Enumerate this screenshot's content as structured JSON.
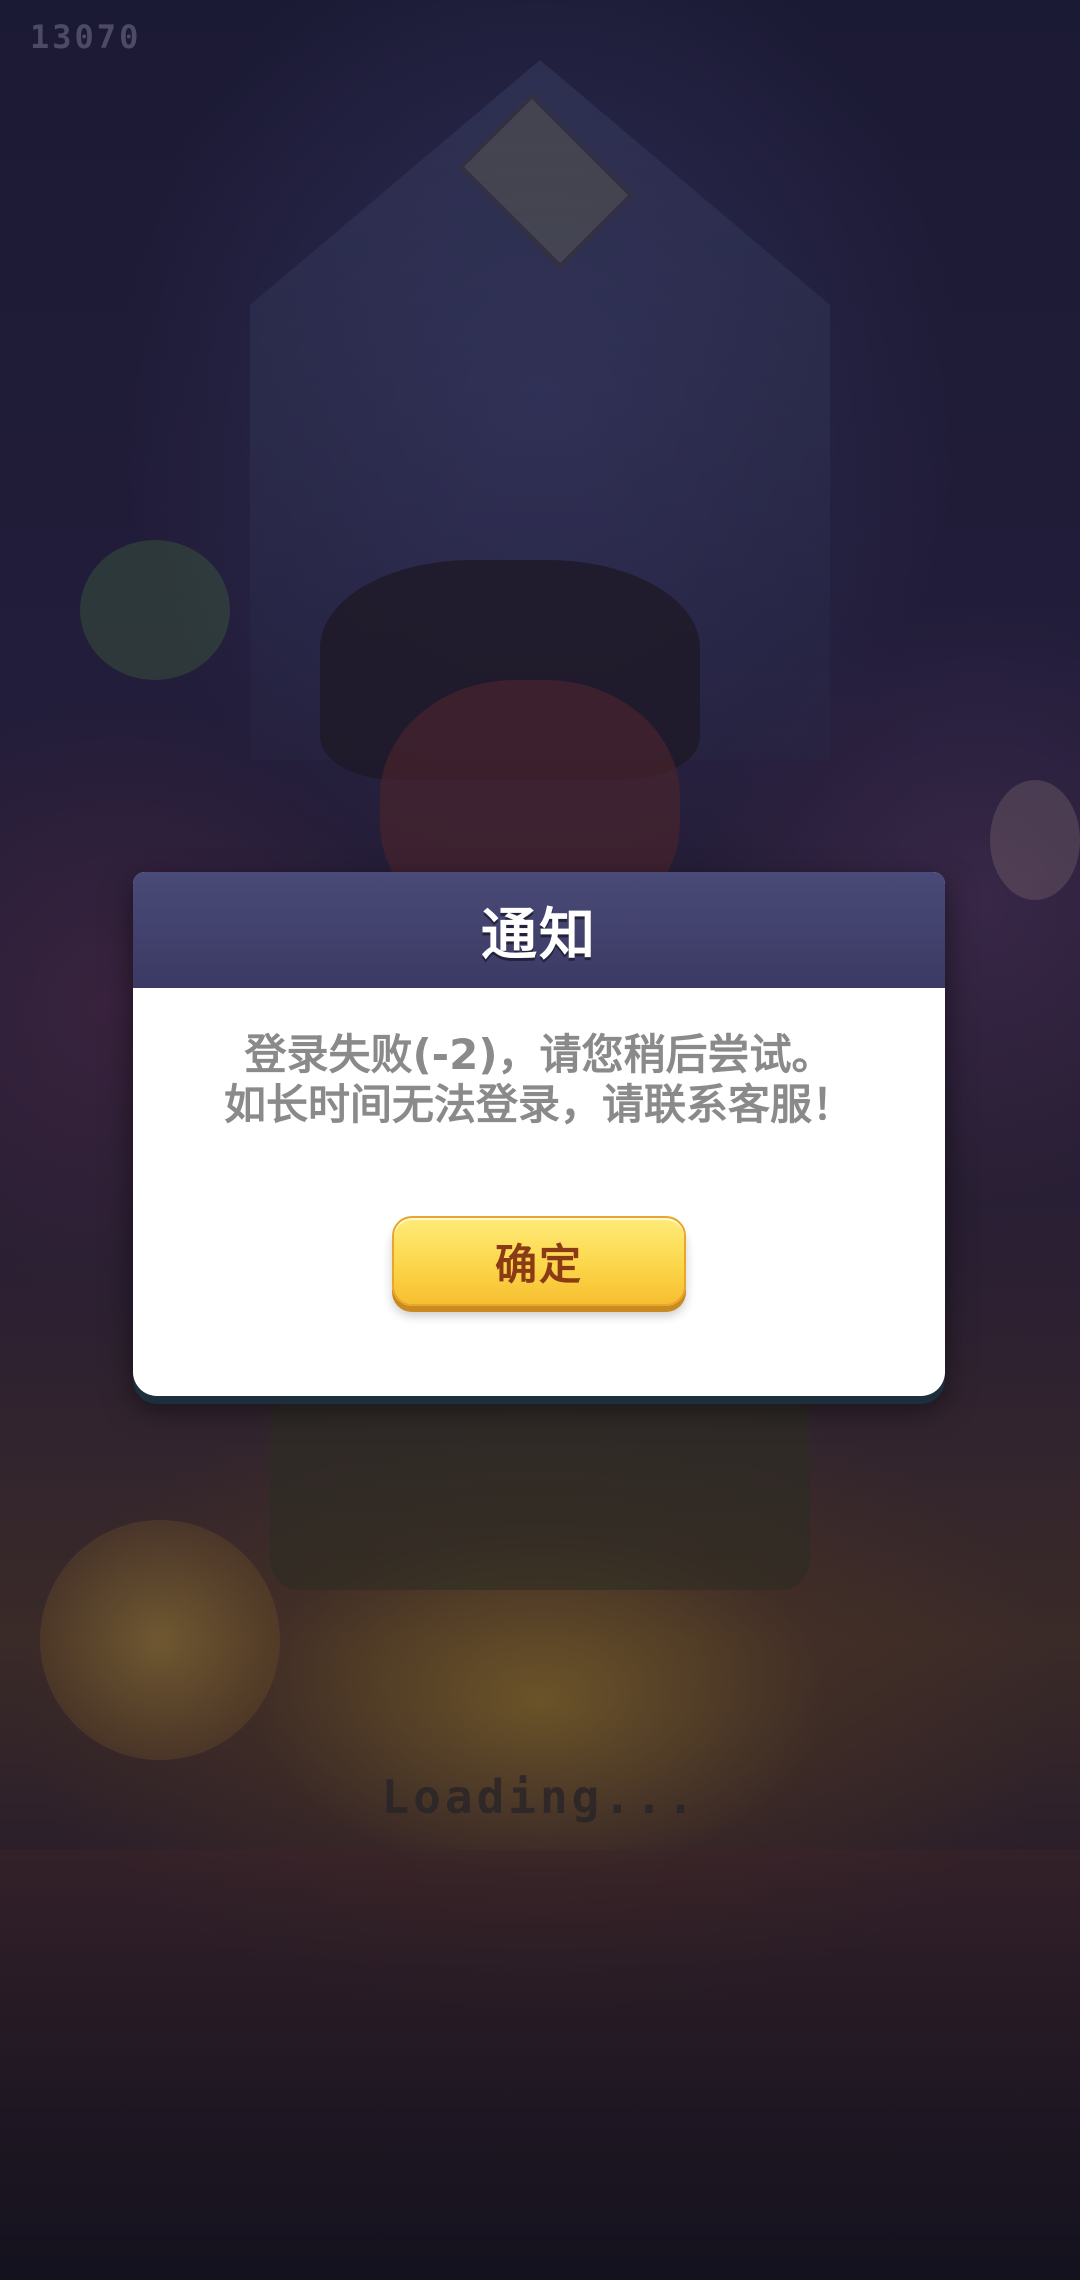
{
  "fps_counter": "13070",
  "dialog": {
    "title": "通知",
    "message_line1": "登录失败(-2)，请您稍后尝试。",
    "message_line2": "如长时间无法登录，请联系客服！",
    "confirm_label": "确定"
  },
  "loading_text": "Loading...",
  "colors": {
    "header": "#3b3a64",
    "button": "#fcd64a",
    "button_text": "#8a3b16",
    "message_text": "#8a8a8a"
  }
}
